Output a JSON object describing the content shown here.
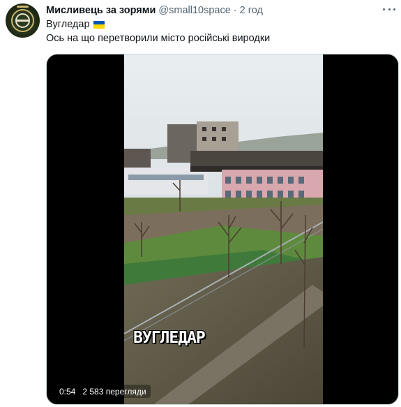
{
  "tweet": {
    "author_name": "Мисливець за зорями",
    "handle": "@small10space",
    "separator": "·",
    "time": "2 год",
    "text_line1": "Вугледар",
    "flag_icon": "ukraine-flag-icon",
    "text_line2": "Ось на що перетворили місто російські виродки"
  },
  "media": {
    "overlay_caption": "ВУГЛЕДАР",
    "duration": "0:54",
    "views": "2 583 перегляди"
  },
  "colors": {
    "text": "#0f1419",
    "secondary": "#536471",
    "border": "#cfd9de",
    "flag_blue": "#0057b7",
    "flag_yellow": "#ffd700"
  }
}
